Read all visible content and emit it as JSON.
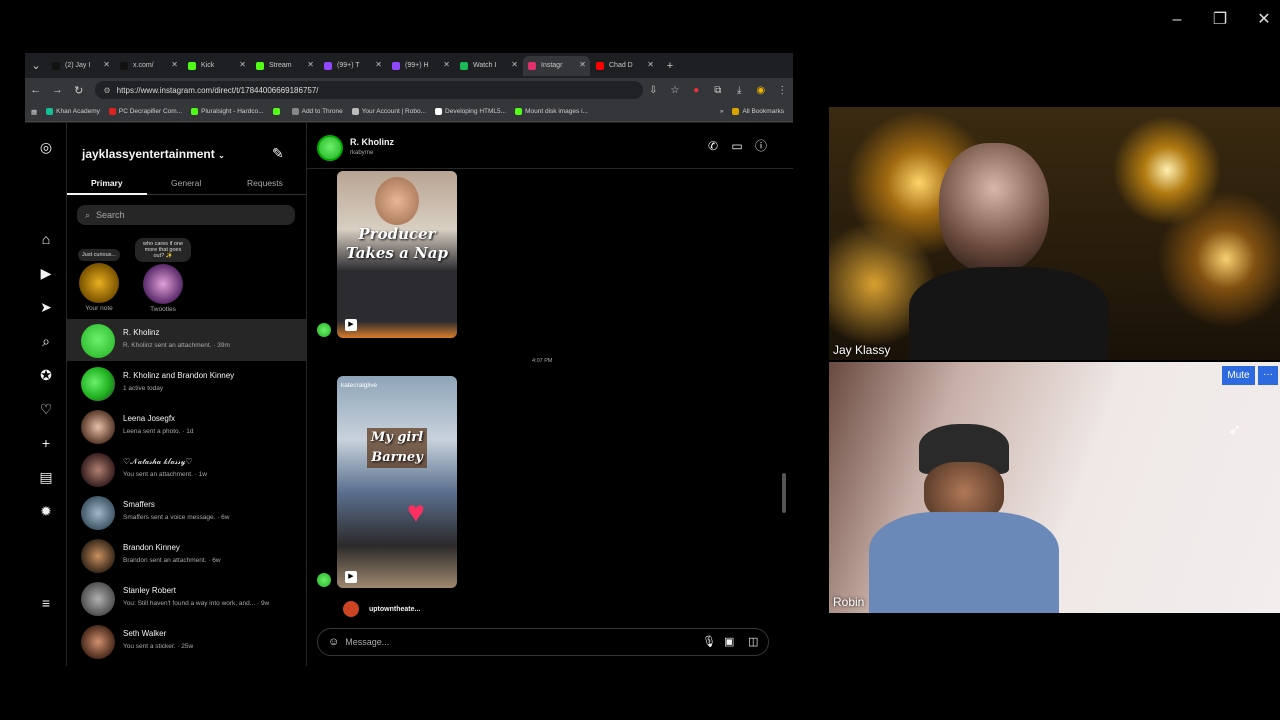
{
  "window": {
    "minimize": "–",
    "restore": "❐",
    "close": "✕"
  },
  "browser": {
    "tabs": [
      {
        "label": "(2) Jay I",
        "color": "#111",
        "active": false
      },
      {
        "label": "x.com/",
        "color": "#111",
        "active": false
      },
      {
        "label": "Kick",
        "color": "#53fc18",
        "active": false
      },
      {
        "label": "Stream",
        "color": "#53fc18",
        "active": false
      },
      {
        "label": "(99+) T",
        "color": "#9146ff",
        "active": false
      },
      {
        "label": "(99+) H",
        "color": "#9146ff",
        "active": false
      },
      {
        "label": "Watch I",
        "color": "#1db954",
        "active": false
      },
      {
        "label": "Instagr",
        "color": "#e1306c",
        "active": true
      },
      {
        "label": "Chad D",
        "color": "#ff0000",
        "active": false
      }
    ],
    "url": "https://www.instagram.com/direct/t/17844006669186757/",
    "bookmarks": [
      {
        "label": "Khan Academy",
        "color": "#14bf96"
      },
      {
        "label": "PC Decrapifier Com...",
        "color": "#d22"
      },
      {
        "label": "Pluralsight - Hardco...",
        "color": "#53fc18"
      },
      {
        "label": "",
        "color": "#53fc18"
      },
      {
        "label": "Add to Throne",
        "color": "#888"
      },
      {
        "label": "Your Account | Robo...",
        "color": "#bbb"
      },
      {
        "label": "Developing HTML5...",
        "color": "#fff"
      },
      {
        "label": "Mount disk images i...",
        "color": "#53fc18"
      }
    ],
    "all_bookmarks": "All Bookmarks"
  },
  "inbox": {
    "account": "jayklassyentertainment",
    "tabs": [
      "Primary",
      "General",
      "Requests"
    ],
    "search_placeholder": "Search",
    "notes": [
      {
        "bubble": "Just curious...",
        "label": "Your note"
      },
      {
        "bubble": "who cares if one more that goes out? ✨",
        "label": "Twootles"
      }
    ],
    "threads": [
      {
        "name": "R. Kholinz",
        "preview": "R. Kholinz sent an attachment. · 39m",
        "selected": true
      },
      {
        "name": "R. Kholinz and Brandon Kinney",
        "preview": "1 active today",
        "selected": false
      },
      {
        "name": "Leena Josegfx",
        "preview": "Leena sent a photo. · 1d",
        "selected": false
      },
      {
        "name": "♡𝒩𝒶𝓉𝒶𝓈𝒽𝒶 𝓀𝓁𝒶𝓈𝓈𝓎♡",
        "preview": "You sent an attachment. · 1w",
        "selected": false
      },
      {
        "name": "Smaffers",
        "preview": "Smaffers sent a voice message. · 6w",
        "selected": false
      },
      {
        "name": "Brandon Kinney",
        "preview": "Brandon sent an attachment. · 6w",
        "selected": false
      },
      {
        "name": "Stanley Robert",
        "preview": "You: Still haven't found a way into work, and... · 9w",
        "selected": false
      },
      {
        "name": "Seth Walker",
        "preview": "You sent a sticker. · 25w",
        "selected": false
      }
    ]
  },
  "chat": {
    "name": "R. Kholinz",
    "username": "rkabyrne",
    "reel1_caption": "Producer Takes a Nap",
    "timestamp": "4:07 PM",
    "reel2_handle": "katecraiglive",
    "reel2_caption": "My girl Barney",
    "reel3_handle": "uptowntheate...",
    "message_placeholder": "Message..."
  },
  "cams": {
    "top_label": "Jay Klassy",
    "bottom_label": "Robin",
    "mute": "Mute",
    "more": "···"
  }
}
